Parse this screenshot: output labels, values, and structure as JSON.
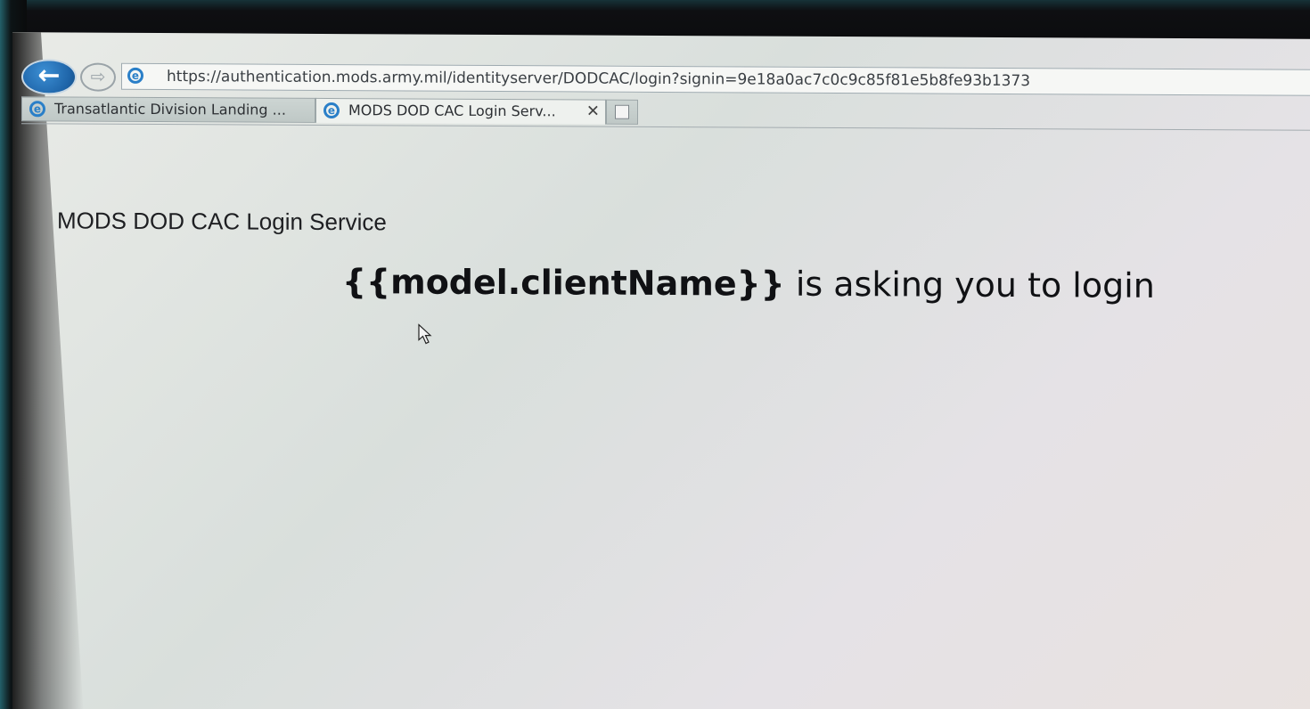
{
  "browser": {
    "back_button_label": "←",
    "forward_button_label": "⇨",
    "url": "https://authentication.mods.army.mil/identityserver/DODCAC/login?signin=9e18a0ac7c0c9c85f81e5b8fe93b1373",
    "site_icon": "ie-icon",
    "tabs": [
      {
        "label": "Transatlantic Division Landing ...",
        "active": false,
        "icon": "ie-icon"
      },
      {
        "label": "MODS DOD CAC Login Serv...",
        "active": true,
        "icon": "ie-icon",
        "close": "✕"
      }
    ],
    "new_tab_icon": "new-tab-icon"
  },
  "page": {
    "title": "MODS DOD CAC Login Service",
    "heading_client": "{{model.clientName}}",
    "heading_rest": " is asking you to login"
  },
  "colors": {
    "back_button": "#1e64a8",
    "page_background": "#e3e5e3",
    "text": "#101114"
  }
}
